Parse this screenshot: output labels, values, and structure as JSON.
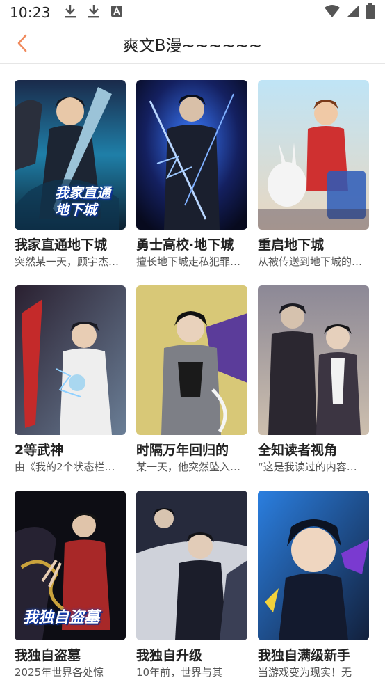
{
  "status_bar": {
    "time": "10:23",
    "icons_left": [
      "download-icon",
      "download-icon",
      "font-icon"
    ],
    "icons_right": [
      "wifi-icon",
      "signal-icon",
      "battery-icon"
    ]
  },
  "nav": {
    "title": "爽文B漫~~~~~~",
    "back_icon": "chevron-left-icon",
    "accent": "#f08a5d"
  },
  "comics": [
    {
      "title": "我家直通地下城",
      "desc": "突然某一天，顾宇杰…",
      "cover_text": "我家直通地下城",
      "colors": [
        "#0b3a5e",
        "#2fa7c9",
        "#1a1f2b"
      ]
    },
    {
      "title": "勇士高校·地下城",
      "desc": "擅长地下城走私犯罪…",
      "cover_text": "",
      "colors": [
        "#0a0f2e",
        "#2f6bff",
        "#121826"
      ]
    },
    {
      "title": "重启地下城",
      "desc": "从被传送到地下城的…",
      "cover_text": "",
      "colors": [
        "#9fd3ef",
        "#e8b07a",
        "#3b2f44"
      ]
    },
    {
      "title": "2等武神",
      "desc": "由《我的2个状态栏…",
      "cover_text": "",
      "colors": [
        "#3a2a3a",
        "#cf2b2b",
        "#a9d7f0"
      ]
    },
    {
      "title": "时隔万年回归的",
      "desc": "某一天，他突然坠入…",
      "cover_text": "",
      "colors": [
        "#d9c97a",
        "#6b4aa6",
        "#2a2a2a"
      ]
    },
    {
      "title": "全知读者视角",
      "desc": "“这是我读过的内容…",
      "cover_text": "",
      "colors": [
        "#6e6a78",
        "#c9b9a8",
        "#2b2730"
      ]
    },
    {
      "title": "我独自盗墓",
      "desc": "2025年世界各处惊",
      "cover_text": "我独自盗墓",
      "colors": [
        "#0d0d14",
        "#b02a2a",
        "#c9a23c"
      ]
    },
    {
      "title": "我独自升级",
      "desc": "10年前，世界与其",
      "cover_text": "",
      "colors": [
        "#1b1d2a",
        "#c9ccd6",
        "#3a3f55"
      ]
    },
    {
      "title": "我独自满级新手",
      "desc": "当游戏变为现实！无",
      "cover_text": "",
      "colors": [
        "#1f6fd0",
        "#7a3ad0",
        "#0e1a33"
      ]
    }
  ]
}
